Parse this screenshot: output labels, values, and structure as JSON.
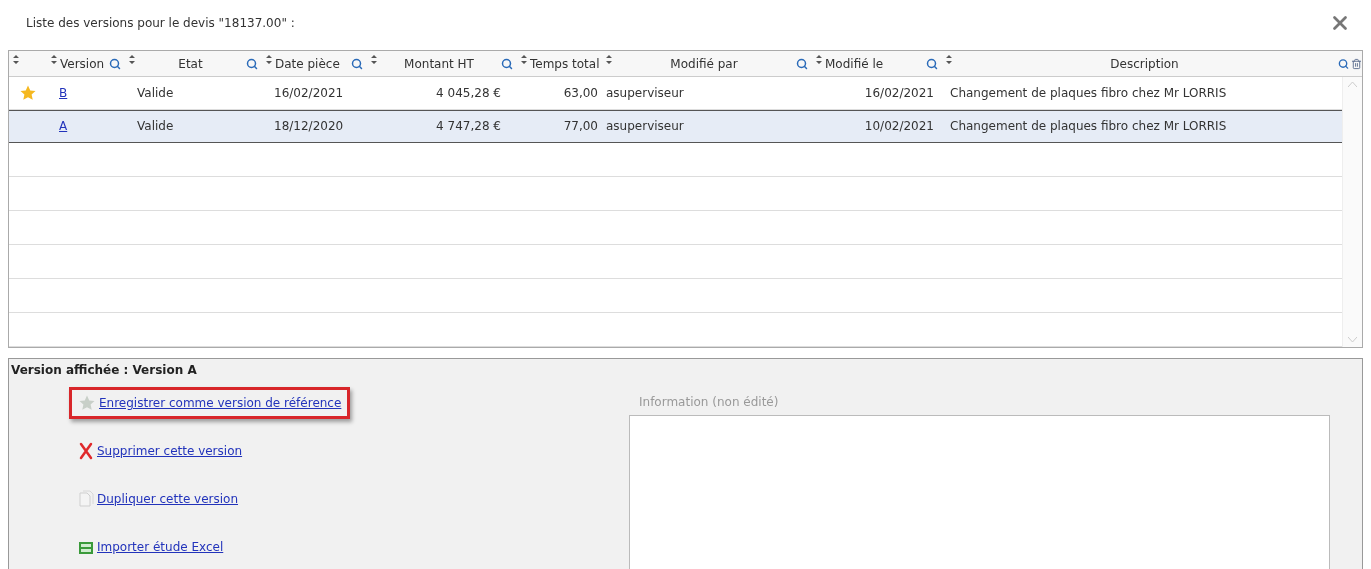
{
  "dialog": {
    "title": "Liste des versions pour le devis \"18137.00\" :"
  },
  "table": {
    "columns": [
      {
        "label": "Version"
      },
      {
        "label": "Etat"
      },
      {
        "label": "Date pièce"
      },
      {
        "label": "Montant HT"
      },
      {
        "label": "Temps total"
      },
      {
        "label": "Modifié par"
      },
      {
        "label": "Modifié le"
      },
      {
        "label": "Description"
      }
    ],
    "rows": [
      {
        "reference": true,
        "selected": false,
        "cells": [
          "B",
          "Valide",
          "16/02/2021",
          "4 045,28 €",
          "63,00",
          "asuperviseur",
          "16/02/2021",
          "Changement de plaques fibro chez Mr LORRIS"
        ]
      },
      {
        "reference": false,
        "selected": true,
        "cells": [
          "A",
          "Valide",
          "18/12/2020",
          "4 747,28 €",
          "77,00",
          "asuperviseur",
          "10/02/2021",
          "Changement de plaques fibro chez Mr LORRIS"
        ]
      }
    ]
  },
  "details": {
    "heading": "Version affichée : Version A",
    "actions": [
      {
        "kind": "star",
        "label": "Enregistrer comme version de référence",
        "highlighted": true
      },
      {
        "kind": "delete",
        "label": "Supprimer cette version",
        "highlighted": false
      },
      {
        "kind": "duplicate",
        "label": "Dupliquer cette version",
        "highlighted": false
      },
      {
        "kind": "excel",
        "label": "Importer étude Excel",
        "highlighted": false
      }
    ],
    "info_label": "Information (non édité)"
  }
}
